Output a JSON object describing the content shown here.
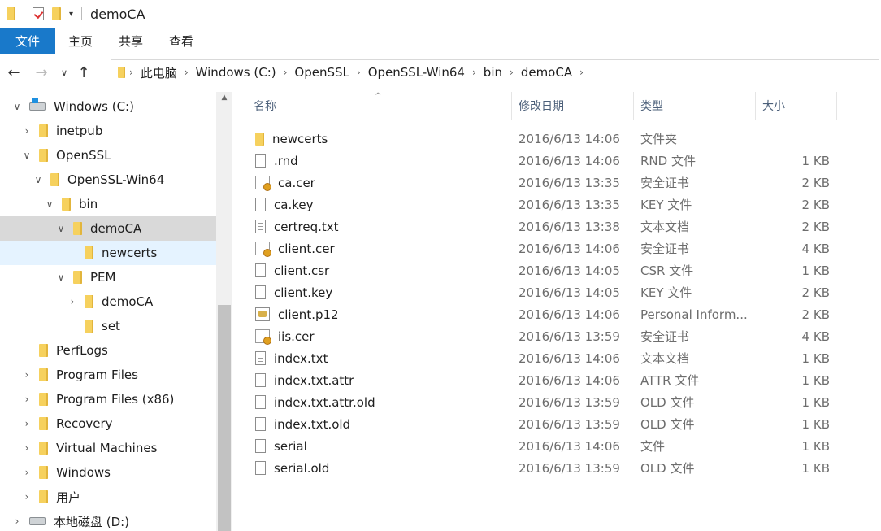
{
  "window": {
    "title": "demoCA"
  },
  "ribbon": {
    "tabs": [
      "文件",
      "主页",
      "共享",
      "查看"
    ]
  },
  "address": {
    "path": [
      "此电脑",
      "Windows (C:)",
      "OpenSSL",
      "OpenSSL-Win64",
      "bin",
      "demoCA"
    ]
  },
  "nav": {
    "items": [
      {
        "label": "Windows (C:)",
        "icon": "windows-drive-icon",
        "chevron": "down",
        "level": 0,
        "state": ""
      },
      {
        "label": "inetpub",
        "icon": "folder-icon",
        "chevron": "right",
        "level": 1,
        "state": ""
      },
      {
        "label": "OpenSSL",
        "icon": "folder-icon",
        "chevron": "down",
        "level": 1,
        "state": ""
      },
      {
        "label": "OpenSSL-Win64",
        "icon": "folder-icon",
        "chevron": "down",
        "level": 2,
        "state": ""
      },
      {
        "label": "bin",
        "icon": "folder-icon",
        "chevron": "down",
        "level": 3,
        "state": ""
      },
      {
        "label": "demoCA",
        "icon": "folder-icon",
        "chevron": "down",
        "level": 4,
        "state": "selected"
      },
      {
        "label": "newcerts",
        "icon": "folder-icon",
        "chevron": "",
        "level": 5,
        "state": "hover"
      },
      {
        "label": "PEM",
        "icon": "folder-icon",
        "chevron": "down",
        "level": 4,
        "state": ""
      },
      {
        "label": "demoCA",
        "icon": "folder-icon",
        "chevron": "right",
        "level": 5,
        "state": ""
      },
      {
        "label": "set",
        "icon": "folder-icon",
        "chevron": "",
        "level": 5,
        "state": ""
      },
      {
        "label": "PerfLogs",
        "icon": "folder-icon",
        "chevron": "",
        "level": 1,
        "state": ""
      },
      {
        "label": "Program Files",
        "icon": "folder-icon",
        "chevron": "right",
        "level": 1,
        "state": ""
      },
      {
        "label": "Program Files (x86)",
        "icon": "folder-icon",
        "chevron": "right",
        "level": 1,
        "state": ""
      },
      {
        "label": "Recovery",
        "icon": "folder-icon",
        "chevron": "right",
        "level": 1,
        "state": ""
      },
      {
        "label": "Virtual Machines",
        "icon": "folder-icon",
        "chevron": "right",
        "level": 1,
        "state": ""
      },
      {
        "label": "Windows",
        "icon": "folder-icon",
        "chevron": "right",
        "level": 1,
        "state": ""
      },
      {
        "label": "用户",
        "icon": "folder-icon",
        "chevron": "right",
        "level": 1,
        "state": ""
      },
      {
        "label": "本地磁盘 (D:)",
        "icon": "drive-icon",
        "chevron": "right",
        "level": 0,
        "state": ""
      }
    ]
  },
  "list": {
    "columns": [
      "名称",
      "修改日期",
      "类型",
      "大小"
    ],
    "files": [
      {
        "name": "newcerts",
        "date": "2016/6/13 14:06",
        "type": "文件夹",
        "size": "",
        "icon": "folder-icon"
      },
      {
        "name": ".rnd",
        "date": "2016/6/13 14:06",
        "type": "RND 文件",
        "size": "1 KB",
        "icon": "file-icon"
      },
      {
        "name": "ca.cer",
        "date": "2016/6/13 13:35",
        "type": "安全证书",
        "size": "2 KB",
        "icon": "certificate-icon"
      },
      {
        "name": "ca.key",
        "date": "2016/6/13 13:35",
        "type": "KEY 文件",
        "size": "2 KB",
        "icon": "file-icon"
      },
      {
        "name": "certreq.txt",
        "date": "2016/6/13 13:38",
        "type": "文本文档",
        "size": "2 KB",
        "icon": "text-file-icon"
      },
      {
        "name": "client.cer",
        "date": "2016/6/13 14:06",
        "type": "安全证书",
        "size": "4 KB",
        "icon": "certificate-icon"
      },
      {
        "name": "client.csr",
        "date": "2016/6/13 14:05",
        "type": "CSR 文件",
        "size": "1 KB",
        "icon": "file-icon"
      },
      {
        "name": "client.key",
        "date": "2016/6/13 14:05",
        "type": "KEY 文件",
        "size": "2 KB",
        "icon": "file-icon"
      },
      {
        "name": "client.p12",
        "date": "2016/6/13 14:06",
        "type": "Personal Inform...",
        "size": "2 KB",
        "icon": "personal-info-exchange-icon"
      },
      {
        "name": "iis.cer",
        "date": "2016/6/13 13:59",
        "type": "安全证书",
        "size": "4 KB",
        "icon": "certificate-icon"
      },
      {
        "name": "index.txt",
        "date": "2016/6/13 14:06",
        "type": "文本文档",
        "size": "1 KB",
        "icon": "text-file-icon"
      },
      {
        "name": "index.txt.attr",
        "date": "2016/6/13 14:06",
        "type": "ATTR 文件",
        "size": "1 KB",
        "icon": "file-icon"
      },
      {
        "name": "index.txt.attr.old",
        "date": "2016/6/13 13:59",
        "type": "OLD 文件",
        "size": "1 KB",
        "icon": "file-icon"
      },
      {
        "name": "index.txt.old",
        "date": "2016/6/13 13:59",
        "type": "OLD 文件",
        "size": "1 KB",
        "icon": "file-icon"
      },
      {
        "name": "serial",
        "date": "2016/6/13 14:06",
        "type": "文件",
        "size": "1 KB",
        "icon": "file-icon"
      },
      {
        "name": "serial.old",
        "date": "2016/6/13 13:59",
        "type": "OLD 文件",
        "size": "1 KB",
        "icon": "file-icon"
      }
    ]
  },
  "colors": {
    "accent": "#1979ca",
    "selected": "#d9d9d9",
    "hover": "#e5f3ff",
    "folder": "#f6d15e"
  }
}
